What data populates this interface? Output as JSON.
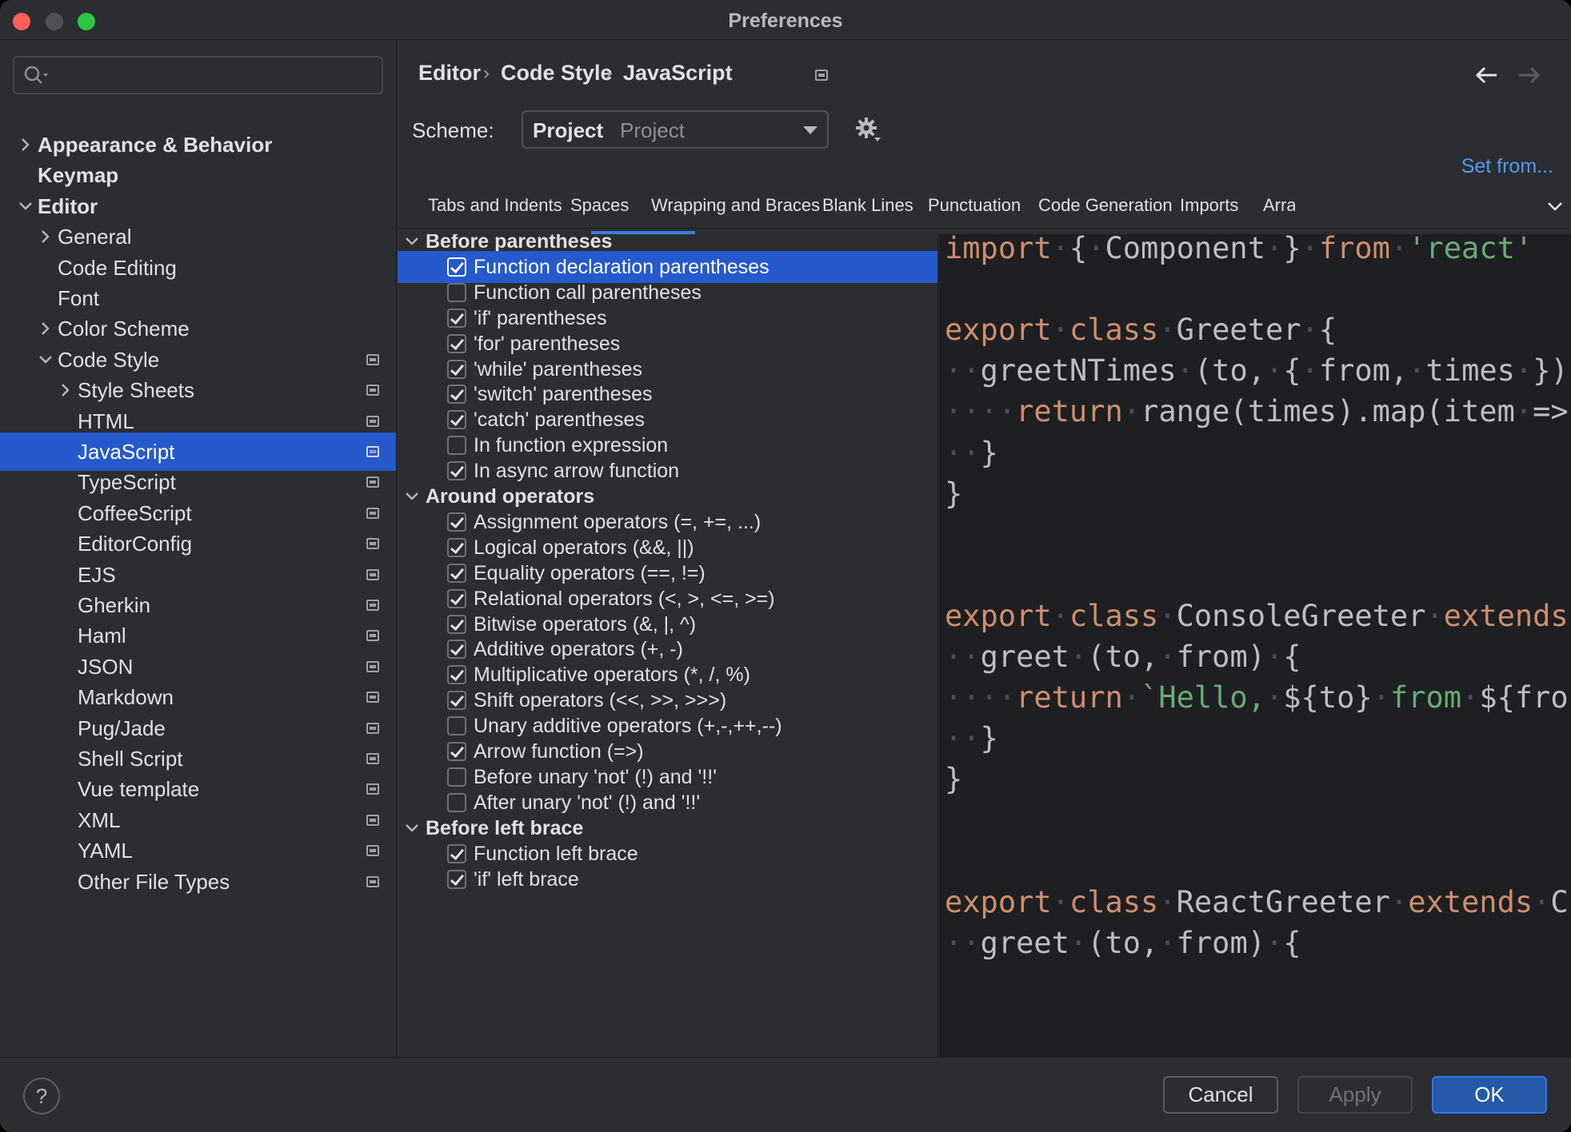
{
  "window": {
    "title": "Preferences"
  },
  "sidebar": {
    "items": [
      {
        "label": "Appearance & Behavior",
        "bold": true,
        "chevron": "right",
        "level": 0
      },
      {
        "label": "Keymap",
        "bold": true,
        "chevron": "",
        "level": 0
      },
      {
        "label": "Editor",
        "bold": true,
        "chevron": "down",
        "level": 0
      },
      {
        "label": "General",
        "chevron": "right",
        "level": 1
      },
      {
        "label": "Code Editing",
        "chevron": "",
        "level": 1
      },
      {
        "label": "Font",
        "chevron": "",
        "level": 1
      },
      {
        "label": "Color Scheme",
        "chevron": "right",
        "level": 1
      },
      {
        "label": "Code Style",
        "chevron": "down",
        "level": 1,
        "project": true
      },
      {
        "label": "Style Sheets",
        "chevron": "right",
        "level": 2,
        "project": true
      },
      {
        "label": "HTML",
        "chevron": "",
        "level": 2,
        "project": true
      },
      {
        "label": "JavaScript",
        "chevron": "",
        "level": 2,
        "project": true,
        "selected": true
      },
      {
        "label": "TypeScript",
        "chevron": "",
        "level": 2,
        "project": true
      },
      {
        "label": "CoffeeScript",
        "chevron": "",
        "level": 2,
        "project": true
      },
      {
        "label": "EditorConfig",
        "chevron": "",
        "level": 2,
        "project": true
      },
      {
        "label": "EJS",
        "chevron": "",
        "level": 2,
        "project": true
      },
      {
        "label": "Gherkin",
        "chevron": "",
        "level": 2,
        "project": true
      },
      {
        "label": "Haml",
        "chevron": "",
        "level": 2,
        "project": true
      },
      {
        "label": "JSON",
        "chevron": "",
        "level": 2,
        "project": true
      },
      {
        "label": "Markdown",
        "chevron": "",
        "level": 2,
        "project": true
      },
      {
        "label": "Pug/Jade",
        "chevron": "",
        "level": 2,
        "project": true
      },
      {
        "label": "Shell Script",
        "chevron": "",
        "level": 2,
        "project": true
      },
      {
        "label": "Vue template",
        "chevron": "",
        "level": 2,
        "project": true
      },
      {
        "label": "XML",
        "chevron": "",
        "level": 2,
        "project": true
      },
      {
        "label": "YAML",
        "chevron": "",
        "level": 2,
        "project": true
      },
      {
        "label": "Other File Types",
        "chevron": "",
        "level": 2,
        "project": true
      }
    ]
  },
  "breadcrumb": {
    "items": [
      "Editor",
      "Code Style",
      "JavaScript"
    ],
    "separator": "›"
  },
  "scheme": {
    "label": "Scheme:",
    "value_bold": "Project",
    "value_sub": "Project",
    "set_from": "Set from..."
  },
  "tabs": {
    "items": [
      "Tabs and Indents",
      "Spaces",
      "Wrapping and Braces",
      "Blank Lines",
      "Punctuation",
      "Code Generation",
      "Imports",
      "Arra"
    ],
    "active": "Spaces"
  },
  "options": [
    {
      "type": "group",
      "label": "Before parentheses"
    },
    {
      "type": "option",
      "label": "Function declaration parentheses",
      "checked": true,
      "selected": true
    },
    {
      "type": "option",
      "label": "Function call parentheses",
      "checked": false
    },
    {
      "type": "option",
      "label": "'if' parentheses",
      "checked": true
    },
    {
      "type": "option",
      "label": "'for' parentheses",
      "checked": true
    },
    {
      "type": "option",
      "label": "'while' parentheses",
      "checked": true
    },
    {
      "type": "option",
      "label": "'switch' parentheses",
      "checked": true
    },
    {
      "type": "option",
      "label": "'catch' parentheses",
      "checked": true
    },
    {
      "type": "option",
      "label": "In function expression",
      "checked": false
    },
    {
      "type": "option",
      "label": "In async arrow function",
      "checked": true
    },
    {
      "type": "group",
      "label": "Around operators"
    },
    {
      "type": "option",
      "label": "Assignment operators (=, +=, ...)",
      "checked": true
    },
    {
      "type": "option",
      "label": "Logical operators (&&, ||)",
      "checked": true
    },
    {
      "type": "option",
      "label": "Equality operators (==, !=)",
      "checked": true
    },
    {
      "type": "option",
      "label": "Relational operators (<, >, <=, >=)",
      "checked": true
    },
    {
      "type": "option",
      "label": "Bitwise operators (&, |, ^)",
      "checked": true
    },
    {
      "type": "option",
      "label": "Additive operators (+, -)",
      "checked": true
    },
    {
      "type": "option",
      "label": "Multiplicative operators (*, /, %)",
      "checked": true
    },
    {
      "type": "option",
      "label": "Shift operators (<<, >>, >>>)",
      "checked": true
    },
    {
      "type": "option",
      "label": "Unary additive operators (+,-,++,--)",
      "checked": false
    },
    {
      "type": "option",
      "label": "Arrow function (=>)",
      "checked": true
    },
    {
      "type": "option",
      "label": "Before unary 'not' (!) and '!!'",
      "checked": false
    },
    {
      "type": "option",
      "label": "After unary 'not' (!) and '!!'",
      "checked": false
    },
    {
      "type": "group",
      "label": "Before left brace"
    },
    {
      "type": "option",
      "label": "Function left brace",
      "checked": true
    },
    {
      "type": "option",
      "label": "'if' left brace",
      "checked": true
    }
  ],
  "code_preview": {
    "lines": [
      [
        [
          "kw",
          "import"
        ],
        [
          "ws",
          "·"
        ],
        [
          "t",
          "{"
        ],
        [
          "ws",
          "·"
        ],
        [
          "t",
          "Component"
        ],
        [
          "ws",
          "·"
        ],
        [
          "t",
          "}"
        ],
        [
          "ws",
          "·"
        ],
        [
          "kw",
          "from"
        ],
        [
          "ws",
          "·"
        ],
        [
          "str",
          "'react'"
        ]
      ],
      [],
      [
        [
          "kw",
          "export"
        ],
        [
          "ws",
          "·"
        ],
        [
          "kw",
          "class"
        ],
        [
          "ws",
          "·"
        ],
        [
          "t",
          "Greeter"
        ],
        [
          "ws",
          "·"
        ],
        [
          "t",
          "{"
        ]
      ],
      [
        [
          "ws",
          "··"
        ],
        [
          "t",
          "greetNTimes"
        ],
        [
          "ws",
          "·"
        ],
        [
          "t",
          "(to,"
        ],
        [
          "ws",
          "·"
        ],
        [
          "t",
          "{"
        ],
        [
          "ws",
          "·"
        ],
        [
          "t",
          "from,"
        ],
        [
          "ws",
          "·"
        ],
        [
          "t",
          "times"
        ],
        [
          "ws",
          "·"
        ],
        [
          "t",
          "})"
        ]
      ],
      [
        [
          "ws",
          "····"
        ],
        [
          "kw",
          "return"
        ],
        [
          "ws",
          "·"
        ],
        [
          "t",
          "range(times).map(item"
        ],
        [
          "ws",
          "·"
        ],
        [
          "t",
          "=>"
        ]
      ],
      [
        [
          "ws",
          "··"
        ],
        [
          "t",
          "}"
        ]
      ],
      [
        [
          "t",
          "}"
        ]
      ],
      [],
      [],
      [
        [
          "kw",
          "export"
        ],
        [
          "ws",
          "·"
        ],
        [
          "kw",
          "class"
        ],
        [
          "ws",
          "·"
        ],
        [
          "t",
          "ConsoleGreeter"
        ],
        [
          "ws",
          "·"
        ],
        [
          "kw",
          "extends"
        ]
      ],
      [
        [
          "ws",
          "··"
        ],
        [
          "t",
          "greet"
        ],
        [
          "ws",
          "·"
        ],
        [
          "t",
          "(to,"
        ],
        [
          "ws",
          "·"
        ],
        [
          "t",
          "from)"
        ],
        [
          "ws",
          "·"
        ],
        [
          "t",
          "{"
        ]
      ],
      [
        [
          "ws",
          "····"
        ],
        [
          "kw",
          "return"
        ],
        [
          "ws",
          "·"
        ],
        [
          "str",
          "`Hello,"
        ],
        [
          "ws",
          "·"
        ],
        [
          "t",
          "${to}"
        ],
        [
          "ws",
          "·"
        ],
        [
          "str",
          "from"
        ],
        [
          "ws",
          "·"
        ],
        [
          "t",
          "${fro"
        ]
      ],
      [
        [
          "ws",
          "··"
        ],
        [
          "t",
          "}"
        ]
      ],
      [
        [
          "t",
          "}"
        ]
      ],
      [],
      [],
      [
        [
          "kw",
          "export"
        ],
        [
          "ws",
          "·"
        ],
        [
          "kw",
          "class"
        ],
        [
          "ws",
          "·"
        ],
        [
          "t",
          "ReactGreeter"
        ],
        [
          "ws",
          "·"
        ],
        [
          "kw",
          "extends"
        ],
        [
          "ws",
          "·"
        ],
        [
          "t",
          "C"
        ]
      ],
      [
        [
          "ws",
          "··"
        ],
        [
          "t",
          "greet"
        ],
        [
          "ws",
          "·"
        ],
        [
          "t",
          "(to,"
        ],
        [
          "ws",
          "·"
        ],
        [
          "t",
          "from)"
        ],
        [
          "ws",
          "·"
        ],
        [
          "t",
          "{"
        ]
      ]
    ]
  },
  "footer": {
    "help": "?",
    "cancel": "Cancel",
    "apply": "Apply",
    "ok": "OK"
  },
  "icons": {
    "search": "search-icon",
    "gear": "gear-icon",
    "back": "arrow-left-icon",
    "forward": "arrow-right-icon"
  },
  "colors": {
    "selection": "#2559cc",
    "link": "#4f9bf5",
    "keyword": "#cf8e6d",
    "string": "#6aab73"
  }
}
